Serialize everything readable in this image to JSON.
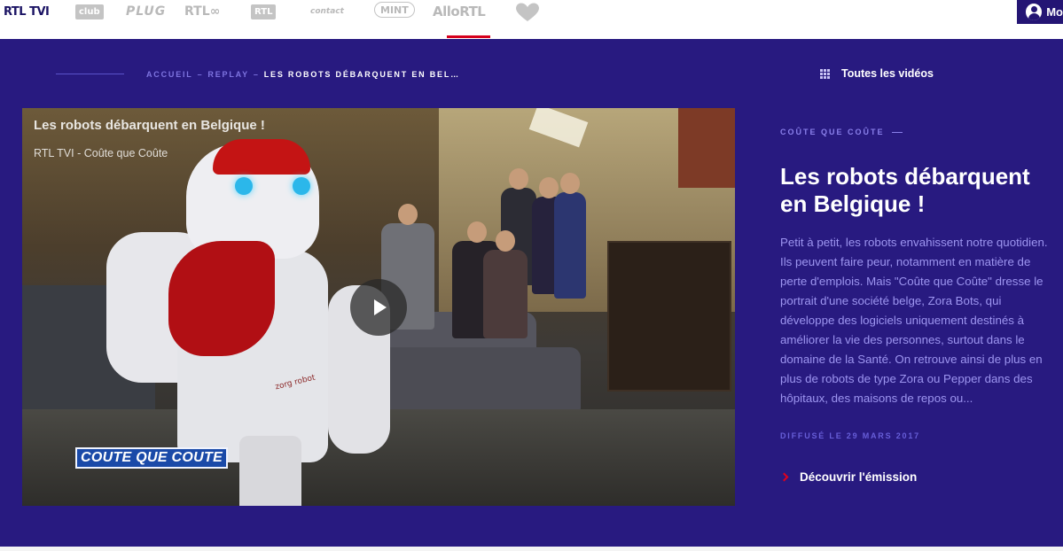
{
  "network_bar": {
    "brands": [
      {
        "name": "RTL TVI"
      },
      {
        "name": "club"
      },
      {
        "name": "PLUG"
      },
      {
        "name": "RTL∞"
      },
      {
        "name": "RTL"
      },
      {
        "name": "contact"
      },
      {
        "name": "MINT"
      },
      {
        "name": "AlloRTL"
      },
      {
        "name": "Bel RTL"
      }
    ],
    "account_label": "Mo",
    "accent_color": "#241574"
  },
  "breadcrumb": {
    "home": "Accueil",
    "separator": "–",
    "section": "Replay",
    "current": "Les robots débarquent en Bel…"
  },
  "all_videos_label": "Toutes les vidéos",
  "video": {
    "title": "Les robots débarquent en Belgique !",
    "subtitle": "RTL TVI - Coûte que Coûte",
    "lower_third": "COUTE QUE COUTE",
    "robot_text": "zorg robot"
  },
  "article": {
    "show_name": "Coûte que coûte",
    "headline": "Les robots débarquent en Belgique !",
    "description": "Petit à petit, les robots envahissent notre quotidien. Ils peuvent faire peur, notamment en matière de perte d'emplois. Mais \"Coûte que Coûte\" dresse le portrait d'une société belge, Zora Bots, qui développe des logiciels uniquement destinés à améliorer la vie des personnes, surtout dans le domaine de la Santé. On retrouve ainsi de plus en plus de robots de type Zora ou Pepper dans des hôpitaux, des maisons de repos ou...",
    "broadcast_date": "Diffusé le 29 mars 2017",
    "discover_label": "Découvrir l'émission"
  },
  "colors": {
    "background": "#281a80",
    "accent_red": "#d6001c",
    "muted_text": "#9d95f0"
  }
}
